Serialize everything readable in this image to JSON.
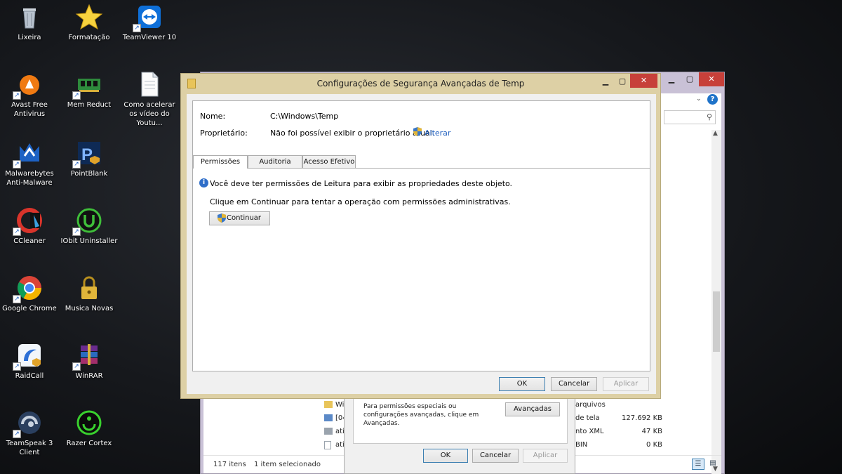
{
  "desktop": {
    "icons": [
      {
        "label": "Lixeira"
      },
      {
        "label": "Formatação"
      },
      {
        "label": "TeamViewer 10"
      },
      {
        "label": "Avast Free Antivirus"
      },
      {
        "label": "Mem Reduct"
      },
      {
        "label": "Como acelerar os vídeo do Youtu..."
      },
      {
        "label": "Malwarebytes Anti-Malware"
      },
      {
        "label": "PointBlank"
      },
      {
        "label": "CCleaner"
      },
      {
        "label": "IObit Uninstaller"
      },
      {
        "label": "Google Chrome"
      },
      {
        "label": "Musica Novas"
      },
      {
        "label": "RaidCall"
      },
      {
        "label": "WinRAR"
      },
      {
        "label": "TeamSpeak 3 Client"
      },
      {
        "label": "Razer Cortex"
      }
    ]
  },
  "explorer": {
    "status_items": "117 itens",
    "status_selected": "1 item selecionado",
    "rows": [
      {
        "name": "Wir",
        "type": "arquivos",
        "size": ""
      },
      {
        "name": "[04",
        "type": "de tela",
        "size": "127.692 KB"
      },
      {
        "name": "ativ",
        "type": "nto XML",
        "size": "47 KB"
      },
      {
        "name": "ativ",
        "type": "BIN",
        "size": "0 KB"
      }
    ]
  },
  "back_dialog": {
    "note": "Para permissões especiais ou configurações avançadas, clique em Avançadas.",
    "advanced_label": "Avançadas",
    "ok_label": "OK",
    "cancel_label": "Cancelar",
    "apply_label": "Aplicar"
  },
  "dialog": {
    "title": "Configurações de Segurança Avançadas de Temp",
    "name_label": "Nome:",
    "name_value": "C:\\Windows\\Temp",
    "owner_label": "Proprietário:",
    "owner_value": "Não foi possível exibir o proprietário atual.",
    "change_link": "Alterar",
    "tabs": [
      "Permissões",
      "Auditoria",
      "Acesso Efetivo"
    ],
    "info_message": "Você deve ter permissões de Leitura para exibir as propriedades deste objeto.",
    "continue_message": "Clique em Continuar para tentar a operação com permissões administrativas.",
    "continue_label": "Continuar",
    "ok_label": "OK",
    "cancel_label": "Cancelar",
    "apply_label": "Aplicar"
  },
  "colors": {
    "dialog_frame": "#ddd0a5",
    "explorer_frame": "#c9c1d6",
    "close_red": "#c7403a",
    "link_blue": "#1f5fbf"
  }
}
